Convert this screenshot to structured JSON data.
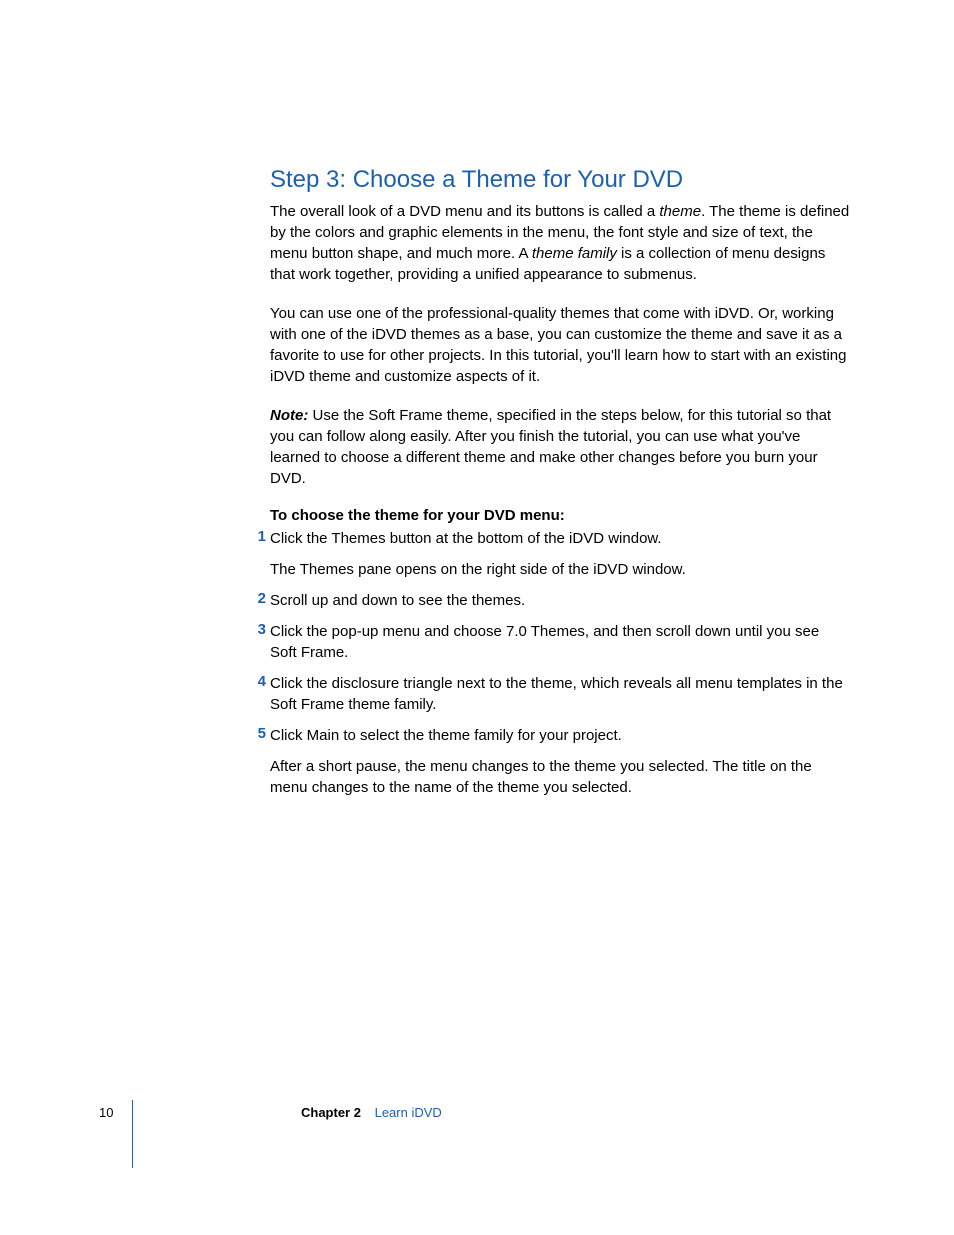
{
  "heading": "Step 3:  Choose a Theme for Your DVD",
  "p1": {
    "a": "The overall look of a DVD menu and its buttons is called a ",
    "b": "theme",
    "c": ". The theme is defined by the colors and graphic elements in the menu, the font style and size of text, the menu button shape, and much more. A ",
    "d": "theme family",
    "e": " is a collection of menu designs that work together, providing a unified appearance to submenus."
  },
  "p2": "You can use one of the professional-quality themes that come with iDVD. Or, working with one of the iDVD themes as a base, you can customize the theme and save it as a favorite to use for other projects. In this tutorial, you'll learn how to start with an existing iDVD theme and customize aspects of it.",
  "p3": {
    "a": "Note:",
    "b": "  Use the Soft Frame theme, specified in the steps below, for this tutorial so that you can follow along easily. After you finish the tutorial, you can use what you've learned to choose a different theme and make other changes before you burn your DVD."
  },
  "subheading": "To choose the theme for your DVD menu:",
  "steps": [
    {
      "num": "1",
      "lines": [
        "Click the Themes button at the bottom of the iDVD window.",
        "The Themes pane opens on the right side of the iDVD window."
      ]
    },
    {
      "num": "2",
      "lines": [
        "Scroll up and down to see the themes."
      ]
    },
    {
      "num": "3",
      "lines": [
        "Click the pop-up menu and choose 7.0 Themes, and then scroll down until you see Soft Frame."
      ]
    },
    {
      "num": "4",
      "lines": [
        "Click the disclosure triangle next to the theme, which reveals all menu templates in the Soft Frame theme family."
      ]
    },
    {
      "num": "5",
      "lines": [
        "Click Main to select the theme family for your project.",
        "After a short pause, the menu changes to the theme you selected. The title on the menu changes to the name of the theme you selected."
      ]
    }
  ],
  "footer": {
    "page": "10",
    "chapterLabel": "Chapter 2",
    "chapterTitle": "Learn iDVD"
  }
}
